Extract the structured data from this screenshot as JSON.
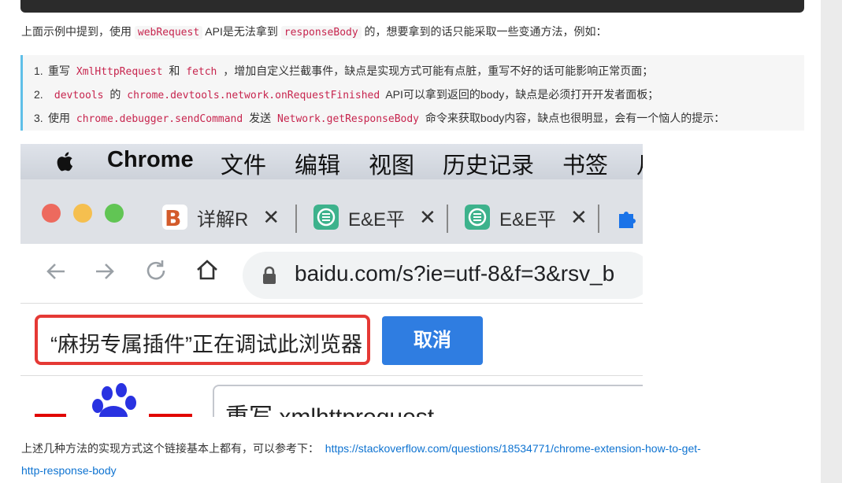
{
  "paragraph1": {
    "t1": "上面示例中提到，使用 ",
    "code1": "webRequest",
    "t2": " API是无法拿到 ",
    "code2": "responseBody",
    "t3": " 的，想要拿到的话只能采取一些变通方法，例如："
  },
  "list": [
    {
      "num": "1.",
      "t1": "重写 ",
      "code1": "XmlHttpRequest",
      "t2": " 和 ",
      "code2": "fetch",
      "t3": " ，增加自定义拦截事件，缺点是实现方式可能有点脏，重写不好的话可能影响正常页面；"
    },
    {
      "num": "2.",
      "t1": " ",
      "code1": "devtools",
      "t2": " 的 ",
      "code2": "chrome.devtools.network.onRequestFinished",
      "t3": " API可以拿到返回的body，缺点是必须打开开发者面板；"
    },
    {
      "num": "3.",
      "t1": "使用 ",
      "code1": "chrome.debugger.sendCommand",
      "t2": " 发送 ",
      "code2": "Network.getResponseBody",
      "t3": " 命令来获取body内容，缺点也很明显，会有一个恼人的提示："
    }
  ],
  "screenshot": {
    "menubar": [
      "Chrome",
      "文件",
      "编辑",
      "视图",
      "历史记录",
      "书签",
      "月"
    ],
    "tabs": [
      {
        "title": "详解R",
        "favicon": "brand-logo-icon"
      },
      {
        "title": "E&E平",
        "favicon": "ee-app-icon"
      },
      {
        "title": "E&E平",
        "favicon": "ee-app-icon"
      }
    ],
    "tab_close": "✕",
    "url": "baidu.com/s?ie=utf-8&f=3&rsv_b",
    "debug_message": "“麻拐专属插件”正在调试此浏览器",
    "cancel_label": "取消",
    "search_text": "重写 xmlhttprequest"
  },
  "paragraph2": {
    "text": "上述几种方法的实现方式这个链接基本上都有，可以参考下：",
    "link1": "https://stackoverflow.com/questions/18534771/chrome-extension-how-to-get-",
    "link2": "http-response-body"
  },
  "colors": {
    "code_text": "#c7254e",
    "link": "#0e73d1",
    "quote_border": "#5fbfe8",
    "alert_border": "#e53935",
    "button": "#2f7de1"
  }
}
